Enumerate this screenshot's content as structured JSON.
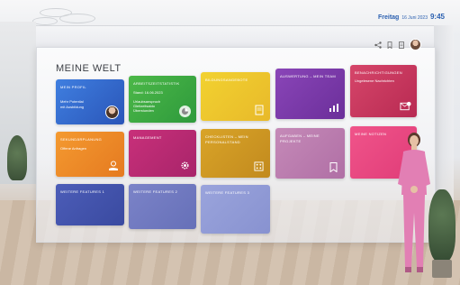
{
  "header": {
    "date_day": "Freitag",
    "date_rest": "16 Juni 2023",
    "time": "9:45"
  },
  "toolbar": {
    "icons": [
      "share-icon",
      "bookmark-icon",
      "document-icon",
      "user-avatar-icon"
    ]
  },
  "page": {
    "title": "MEINE WELT"
  },
  "tiles": [
    {
      "title": "Mein Profil",
      "lines": [
        "Mehr Potential",
        "mit Ausbildung"
      ],
      "color_from": "#3f7fe0",
      "color_to": "#2a55b8",
      "icon": "profile-avatar-icon"
    },
    {
      "title": "Arbeitszeitstatistik",
      "lines": [
        "Stand: 16.06.2023",
        "Urlaubsanspruch",
        "Gleitzeitsaldo",
        "Überstunden"
      ],
      "color_from": "#4cb848",
      "color_to": "#2e9a3c",
      "icon": "pie-chart-icon"
    },
    {
      "title": "Bildungsangebote",
      "lines": [],
      "color_from": "#f2d230",
      "color_to": "#e8b92a",
      "icon": "document-icon"
    },
    {
      "title": "Auswertung – Mein Team",
      "lines": [],
      "color_from": "#8a45b8",
      "color_to": "#6b2f9a",
      "icon": "bar-chart-icon"
    },
    {
      "title": "Benachrichtigungen",
      "lines": [
        "Ungelesene Nachrichten"
      ],
      "color_from": "#d6466a",
      "color_to": "#b82a52",
      "icon": "mail-check-icon"
    },
    {
      "title": "Sekundärplanung",
      "lines": [
        "Offene Anfragen"
      ],
      "color_from": "#f49a30",
      "color_to": "#e57a20",
      "icon": "hand-coin-icon"
    },
    {
      "title": "Management",
      "lines": [],
      "color_from": "#c8307a",
      "color_to": "#a8246a",
      "icon": "gear-icon"
    },
    {
      "title": "Checklisten – Mein Personalstand",
      "lines": [],
      "color_from": "#d9a428",
      "color_to": "#c28a1e",
      "icon": "abacus-icon"
    },
    {
      "title": "Aufgaben – Meine Projekte",
      "lines": [],
      "color_from": "#c58ab8",
      "color_to": "#b06fa5",
      "icon": "bookmark-icon"
    },
    {
      "title": "Meine Notizen",
      "lines": [],
      "color_from": "#f0548a",
      "color_to": "#e03c78",
      "icon": ""
    },
    {
      "title": "Weitere Features 1",
      "lines": [],
      "color_from": "#4c5db8",
      "color_to": "#3a4aa0",
      "icon": ""
    },
    {
      "title": "Weitere Features 2",
      "lines": [],
      "color_from": "#7b83c8",
      "color_to": "#6670b8",
      "icon": ""
    },
    {
      "title": "Weitere Features 3",
      "lines": [],
      "color_from": "#9aa4dc",
      "color_to": "#8892d0",
      "icon": ""
    }
  ]
}
